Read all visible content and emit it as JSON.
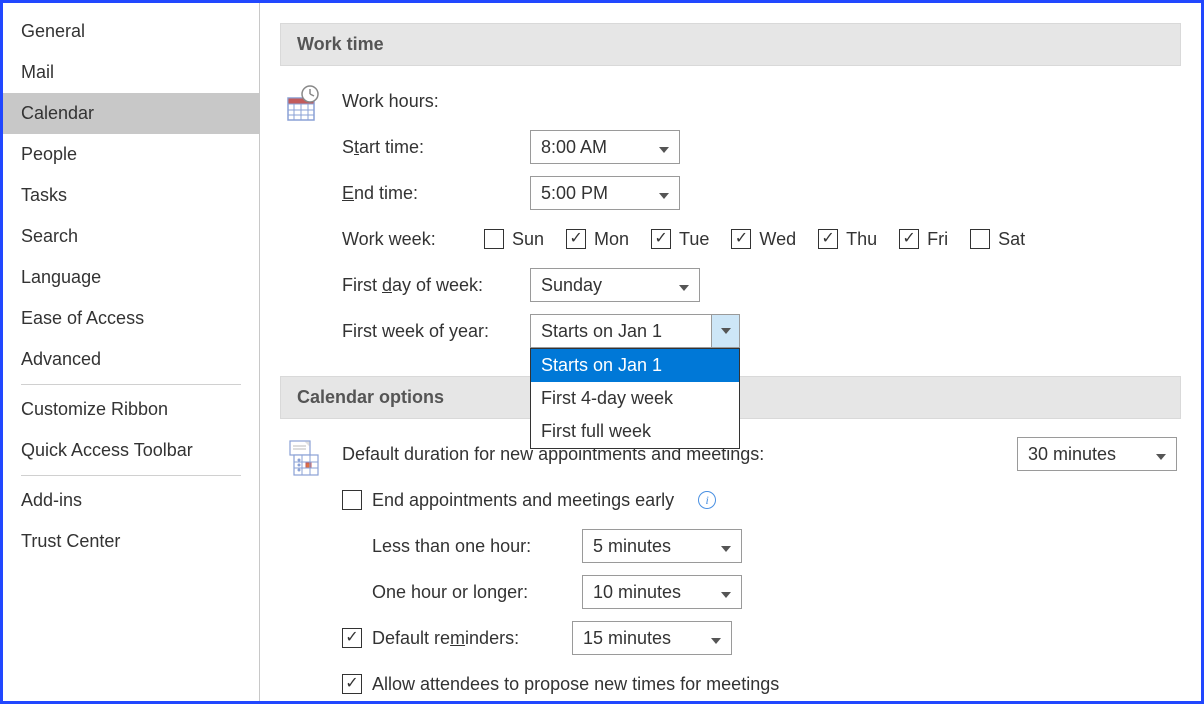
{
  "sidebar": {
    "items": [
      {
        "label": "General"
      },
      {
        "label": "Mail"
      },
      {
        "label": "Calendar"
      },
      {
        "label": "People"
      },
      {
        "label": "Tasks"
      },
      {
        "label": "Search"
      },
      {
        "label": "Language"
      },
      {
        "label": "Ease of Access"
      },
      {
        "label": "Advanced"
      },
      {
        "label": "Customize Ribbon"
      },
      {
        "label": "Quick Access Toolbar"
      },
      {
        "label": "Add-ins"
      },
      {
        "label": "Trust Center"
      }
    ],
    "selected": "Calendar"
  },
  "work_time": {
    "header": "Work time",
    "work_hours_label": "Work hours:",
    "start_time_label_pre": "S",
    "start_time_label_u": "t",
    "start_time_label_post": "art time:",
    "start_time_value": "8:00 AM",
    "end_time_label_u": "E",
    "end_time_label_post": "nd time:",
    "end_time_value": "5:00 PM",
    "work_week_label": "Work week:",
    "days": [
      {
        "label": "Sun",
        "checked": false
      },
      {
        "label": "Mon",
        "checked": true
      },
      {
        "label": "Tue",
        "checked": true
      },
      {
        "label": "Wed",
        "checked": true
      },
      {
        "label": "Thu",
        "checked": true
      },
      {
        "label": "Fri",
        "checked": true
      },
      {
        "label": "Sat",
        "checked": false
      }
    ],
    "first_day_label_pre": "First ",
    "first_day_label_u": "d",
    "first_day_label_post": "ay of week:",
    "first_day_value": "Sunday",
    "first_week_label": "First week of year:",
    "first_week_value": "Starts on Jan 1",
    "first_week_options": [
      "Starts on Jan 1",
      "First 4-day week",
      "First full week"
    ]
  },
  "calendar_options": {
    "header": "Calendar options",
    "default_duration_label": "Default duration for new appointments and meetings:",
    "default_duration_value": "30 minutes",
    "end_early_label": "End appointments and meetings early",
    "end_early_checked": false,
    "less_than_hour_label": "Less than one hour:",
    "less_than_hour_value": "5 minutes",
    "one_hour_or_longer_label": "One hour or longer:",
    "one_hour_or_longer_value": "10 minutes",
    "default_reminders_label_pre": "Default re",
    "default_reminders_label_u": "m",
    "default_reminders_label_post": "inders:",
    "default_reminders_value": "15 minutes",
    "default_reminders_checked": true,
    "allow_propose_label": "Allow attendees to propose new times for meetings",
    "allow_propose_checked": true
  }
}
